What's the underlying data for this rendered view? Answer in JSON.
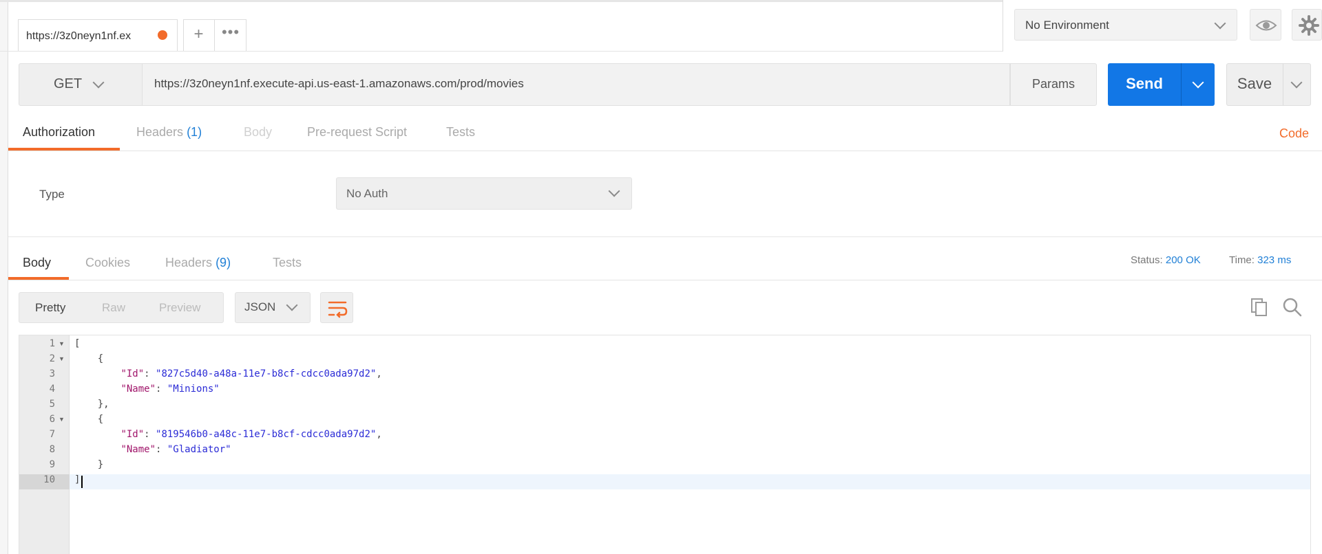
{
  "tabs": {
    "active_tab_label": "https://3z0neyn1nf.ex",
    "plus": "+",
    "more": "•••"
  },
  "environment": {
    "selected": "No Environment"
  },
  "request": {
    "method": "GET",
    "url": "https://3z0neyn1nf.execute-api.us-east-1.amazonaws.com/prod/movies",
    "params_label": "Params",
    "send_label": "Send",
    "save_label": "Save"
  },
  "request_tabs": {
    "authorization": "Authorization",
    "headers": "Headers",
    "headers_count": "(1)",
    "body": "Body",
    "pre_request": "Pre-request Script",
    "tests": "Tests",
    "code_link": "Code"
  },
  "auth": {
    "type_label": "Type",
    "selected": "No Auth"
  },
  "response_tabs": {
    "body": "Body",
    "cookies": "Cookies",
    "headers": "Headers",
    "headers_count": "(9)",
    "tests": "Tests"
  },
  "response_meta": {
    "status_label": "Status:",
    "status_value": "200 OK",
    "time_label": "Time:",
    "time_value": "323 ms"
  },
  "view": {
    "pretty": "Pretty",
    "raw": "Raw",
    "preview": "Preview",
    "format": "JSON"
  },
  "editor": {
    "line_numbers": [
      "1",
      "2",
      "3",
      "4",
      "5",
      "6",
      "7",
      "8",
      "9",
      "10"
    ],
    "lines": [
      {
        "text": "["
      },
      {
        "text": "    {"
      },
      {
        "key": "\"Id\"",
        "value": "\"827c5d40-a48a-11e7-b8cf-cdcc0ada97d2\"",
        "trail": ","
      },
      {
        "key": "\"Name\"",
        "value": "\"Minions\"",
        "trail": ""
      },
      {
        "text": "    },"
      },
      {
        "text": "    {"
      },
      {
        "key": "\"Id\"",
        "value": "\"819546b0-a48c-11e7-b8cf-cdcc0ada97d2\"",
        "trail": ","
      },
      {
        "key": "\"Name\"",
        "value": "\"Gladiator\"",
        "trail": ""
      },
      {
        "text": "    }"
      },
      {
        "text": "]"
      }
    ]
  },
  "colors": {
    "accent": "#f26b2a",
    "send": "#1277e6",
    "link": "#1f7fd6"
  }
}
